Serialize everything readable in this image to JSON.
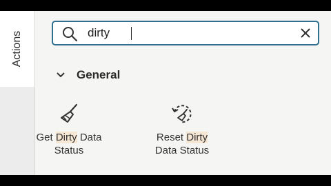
{
  "side_tab": {
    "label": "Actions"
  },
  "search": {
    "value": "dirty",
    "placeholder": ""
  },
  "group": {
    "title": "General"
  },
  "items": [
    {
      "icon": "broom-icon",
      "pre": "Get ",
      "highlight": "Dirty",
      "post": " Data",
      "line2": "Status"
    },
    {
      "icon": "reset-broom-icon",
      "pre": "Reset ",
      "highlight": "Dirty",
      "post": "",
      "line2": "Data Status"
    }
  ],
  "colors": {
    "search_border": "#2f6f8f",
    "highlight": "#f6e6d4"
  }
}
